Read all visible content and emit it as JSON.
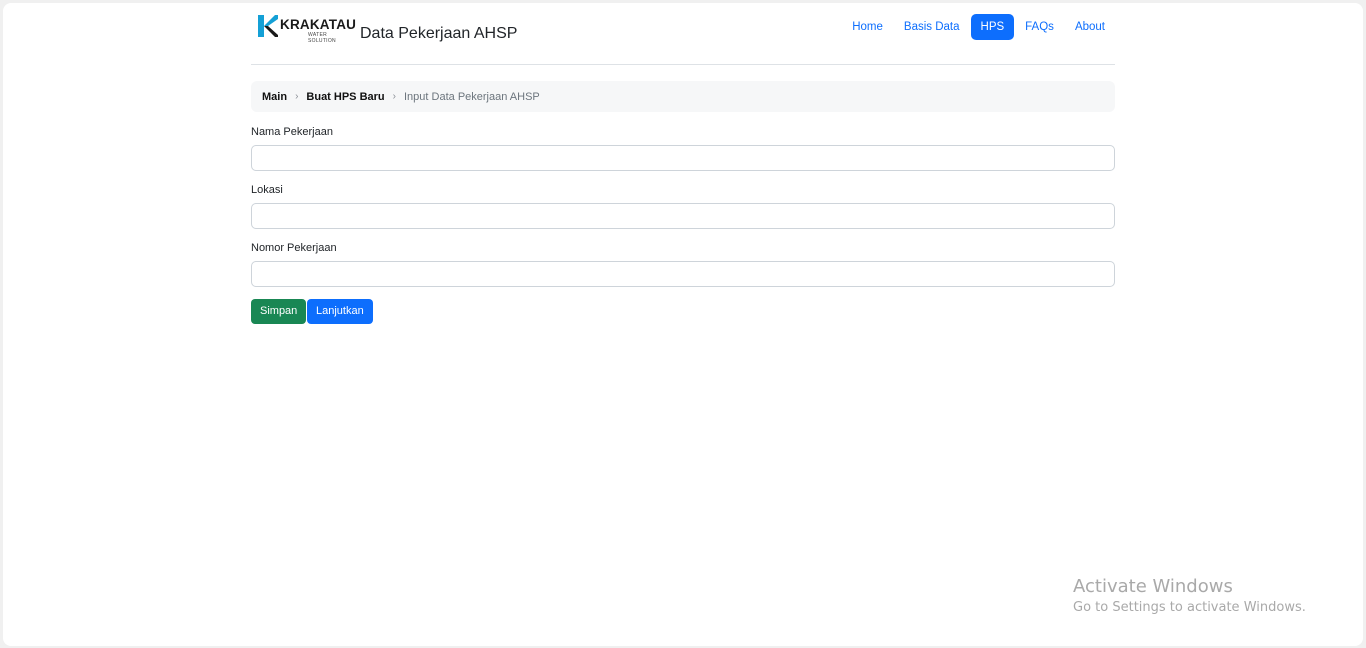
{
  "header": {
    "logo_text": "KRAKATAU",
    "logo_subtext": "WATER SOLUTION",
    "app_title": "Data Pekerjaan AHSP",
    "nav": [
      {
        "label": "Home",
        "active": false
      },
      {
        "label": "Basis Data",
        "active": false
      },
      {
        "label": "HPS",
        "active": true
      },
      {
        "label": "FAQs",
        "active": false
      },
      {
        "label": "About",
        "active": false
      }
    ]
  },
  "breadcrumb": [
    {
      "label": "Main"
    },
    {
      "label": "Buat HPS Baru"
    },
    {
      "label": "Input Data Pekerjaan AHSP"
    }
  ],
  "form": {
    "fields": [
      {
        "label": "Nama Pekerjaan",
        "value": ""
      },
      {
        "label": "Lokasi",
        "value": ""
      },
      {
        "label": "Nomor Pekerjaan",
        "value": ""
      }
    ],
    "save_label": "Simpan",
    "next_label": "Lanjutkan"
  },
  "watermark": {
    "title": "Activate Windows",
    "subtitle": "Go to Settings to activate Windows."
  },
  "colors": {
    "primary": "#0d6efd",
    "success": "#198754",
    "logo_cyan": "#14a0d6",
    "breadcrumb_bg": "#f6f7f8"
  }
}
